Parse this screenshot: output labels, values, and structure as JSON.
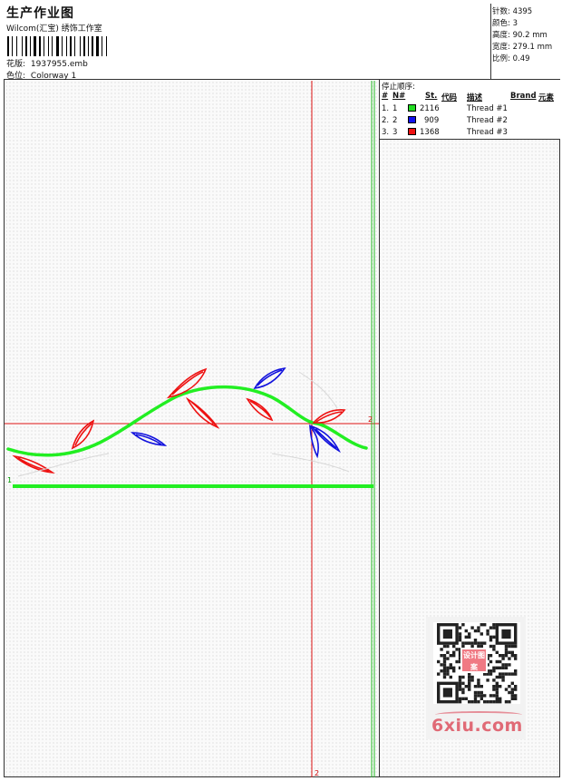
{
  "header": {
    "title": "生产作业图",
    "company": "Wilcom(汇宝) 绣饰工作室",
    "design_label": "花版:",
    "design_value": "1937955.emb",
    "colorway_label": "色位:",
    "colorway_value": "Colorway 1"
  },
  "stats": {
    "stitches_label": "针数:",
    "stitches": "4395",
    "colors_label": "颜色:",
    "colors": "3",
    "height_label": "高度:",
    "height": "90.2 mm",
    "width_label": "宽度:",
    "width": "279.1 mm",
    "scale_label": "比例:",
    "scale": "0.49"
  },
  "stop_sequence": {
    "title": "停止顺序:",
    "columns": [
      "#",
      "N#",
      "St.",
      "代码",
      "描述",
      "Brand",
      "元素"
    ],
    "rows": [
      {
        "idx": "1.",
        "n": "1",
        "color": "#22dd22",
        "stitches": "2116",
        "desc": "Thread #1"
      },
      {
        "idx": "2.",
        "n": "2",
        "color": "#1111ee",
        "stitches": "909",
        "desc": "Thread #2"
      },
      {
        "idx": "3.",
        "n": "3",
        "color": "#ee1111",
        "stitches": "1368",
        "desc": "Thread #3"
      }
    ]
  },
  "markers": {
    "green_left": "1",
    "red_right": "2",
    "red_bottom": "2"
  },
  "colors": {
    "green": "#22ee22",
    "blue": "#1111dd",
    "red": "#ee1111",
    "guide_red": "#dd1111",
    "guide_green": "#22bb22"
  },
  "watermark": {
    "site": "6xiu.com",
    "badge": "设计图案"
  }
}
